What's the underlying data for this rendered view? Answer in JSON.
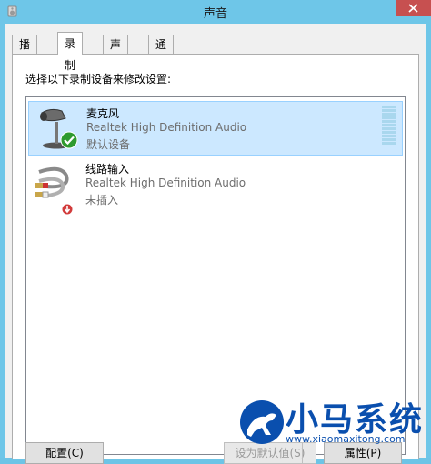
{
  "window": {
    "title": "声音"
  },
  "tabs": [
    {
      "label": "播放"
    },
    {
      "label": "录制"
    },
    {
      "label": "声音"
    },
    {
      "label": "通信"
    }
  ],
  "instruction": "选择以下录制设备来修改设置:",
  "devices": [
    {
      "name": "麦克风",
      "driver": "Realtek High Definition Audio",
      "status": "默认设备",
      "icon": "microphone-icon",
      "badge": "default-check-icon"
    },
    {
      "name": "线路输入",
      "driver": "Realtek High Definition Audio",
      "status": "未插入",
      "icon": "line-in-cable-icon",
      "badge": "unplugged-arrow-icon"
    }
  ],
  "buttons": {
    "configure": "配置(C)",
    "set_default": "设为默认值(S)",
    "properties": "属性(P)"
  },
  "watermark": {
    "title": "小马系统",
    "url": "www.xiaomaxitong.com"
  },
  "colors": {
    "titlebar": "#6ec6e8",
    "selected_row": "#cce8ff",
    "close_button": "#c75050",
    "watermark": "#0a4fae"
  }
}
